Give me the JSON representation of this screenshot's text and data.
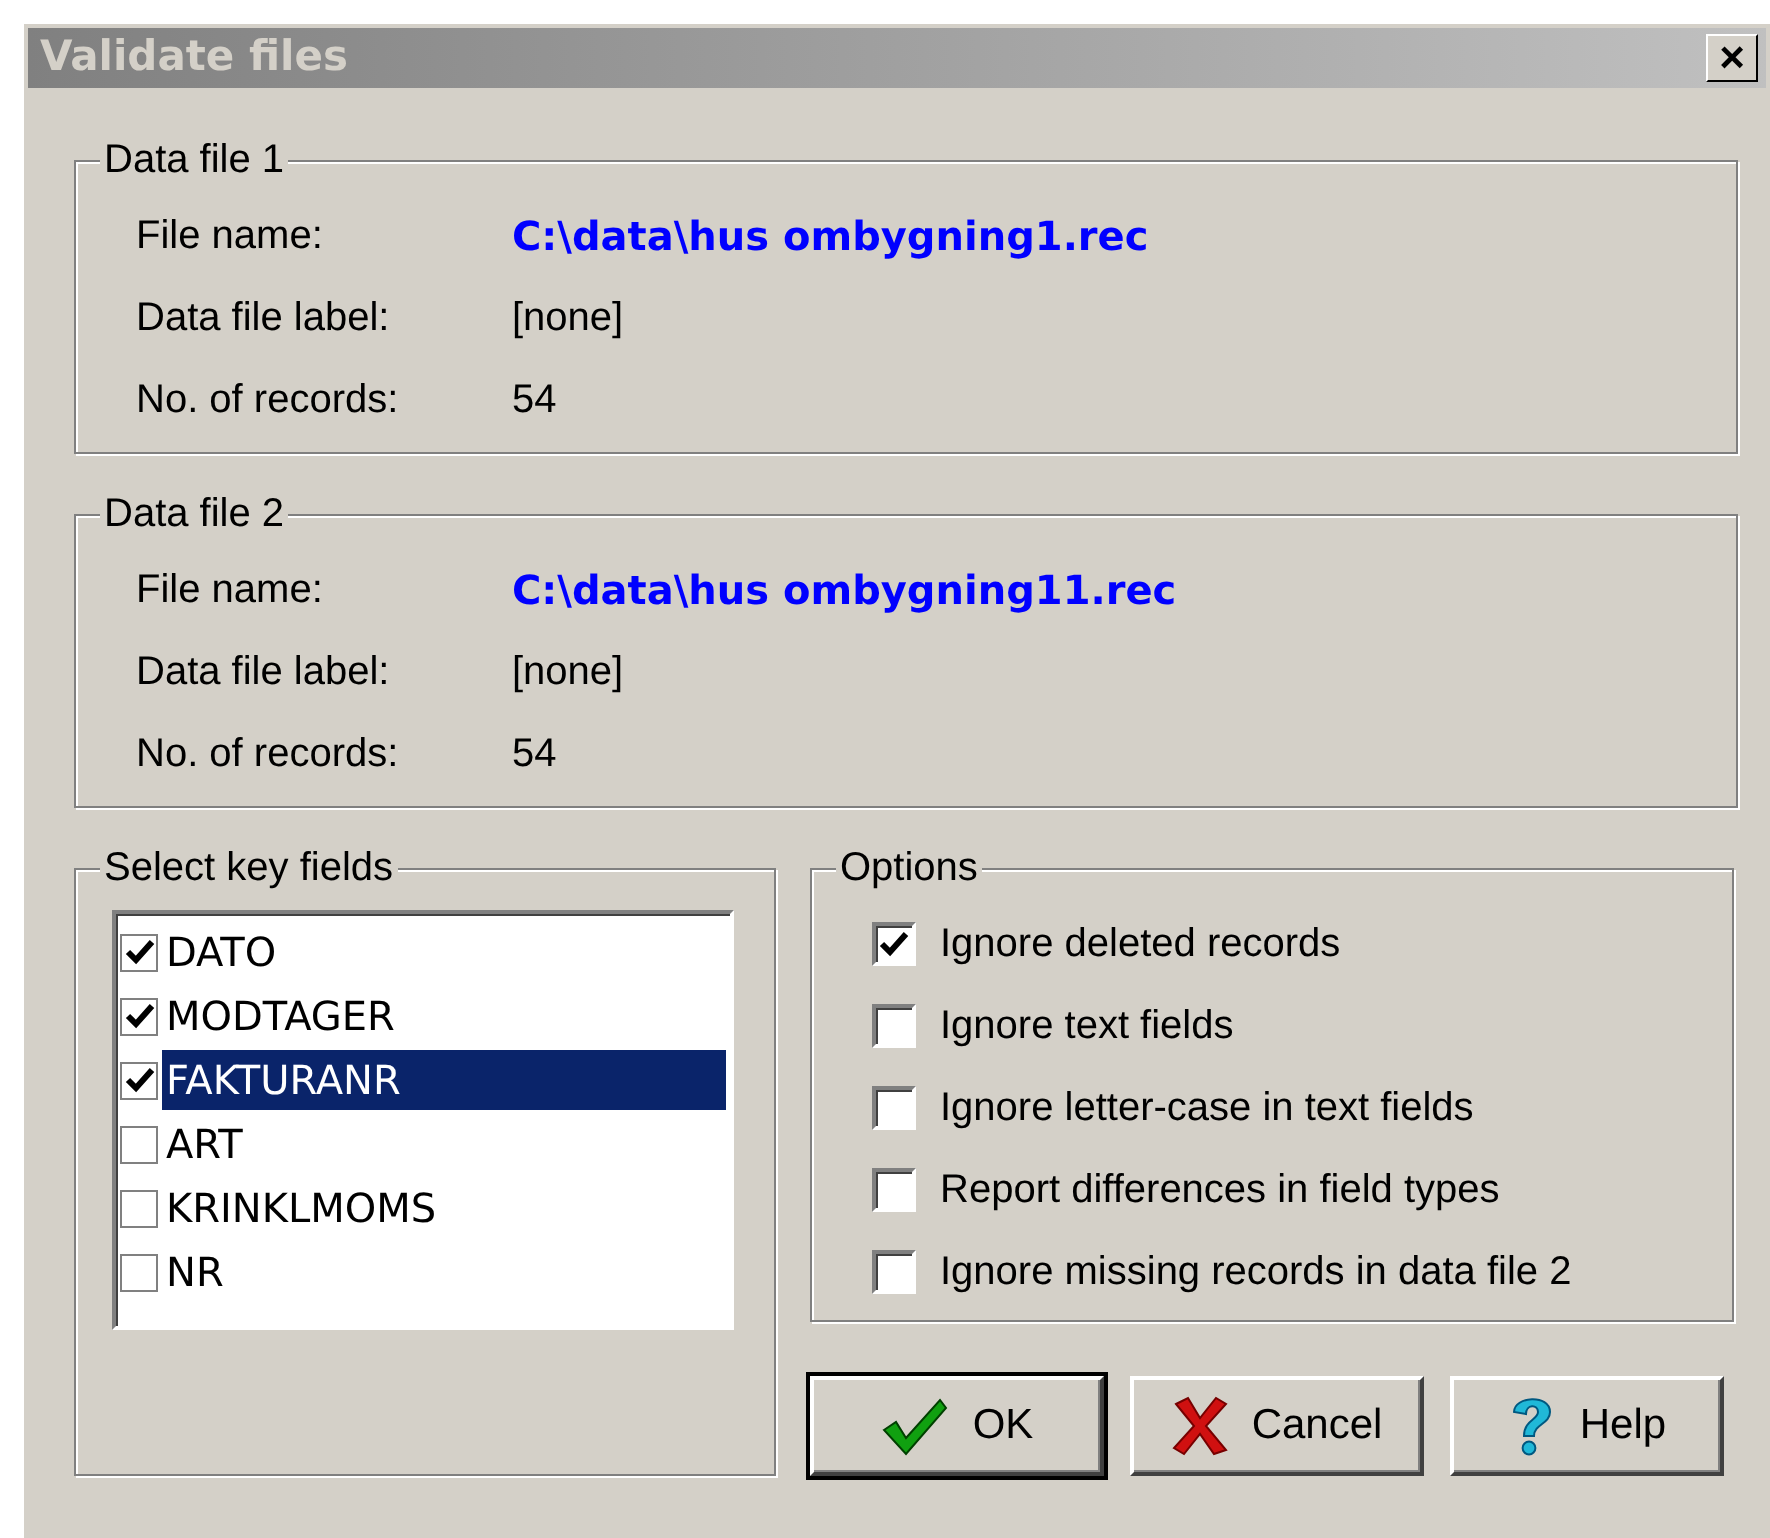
{
  "window": {
    "title": "Validate files",
    "close": "×"
  },
  "data_files": [
    {
      "title": "Data file 1",
      "rows": [
        {
          "label": "File name:",
          "value": "C:\\data\\hus ombygning1.rec",
          "kind": "path"
        },
        {
          "label": "Data file label:",
          "value": "[none]",
          "kind": "plain"
        },
        {
          "label": "No. of records:",
          "value": "54",
          "kind": "plain"
        }
      ]
    },
    {
      "title": "Data file 2",
      "rows": [
        {
          "label": "File name:",
          "value": "C:\\data\\hus ombygning11.rec",
          "kind": "path"
        },
        {
          "label": "Data file label:",
          "value": "[none]",
          "kind": "plain"
        },
        {
          "label": "No. of records:",
          "value": "54",
          "kind": "plain"
        }
      ]
    }
  ],
  "key_fields": {
    "title": "Select key fields",
    "items": [
      {
        "label": "DATO",
        "checked": true,
        "selected": false
      },
      {
        "label": "MODTAGER",
        "checked": true,
        "selected": false
      },
      {
        "label": "FAKTURANR",
        "checked": true,
        "selected": true
      },
      {
        "label": "ART",
        "checked": false,
        "selected": false
      },
      {
        "label": "KRINKLMOMS",
        "checked": false,
        "selected": false
      },
      {
        "label": "NR",
        "checked": false,
        "selected": false
      }
    ]
  },
  "options": {
    "title": "Options",
    "items": [
      {
        "label": "Ignore deleted records",
        "checked": true
      },
      {
        "label": "Ignore text fields",
        "checked": false
      },
      {
        "label": "Ignore letter-case in text fields",
        "checked": false
      },
      {
        "label": "Report differences in field types",
        "checked": false
      },
      {
        "label": "Ignore missing records in data file 2",
        "checked": false
      }
    ]
  },
  "buttons": [
    {
      "label": "OK",
      "kind": "ok",
      "default": true
    },
    {
      "label": "Cancel",
      "kind": "cancel",
      "default": false
    },
    {
      "label": "Help",
      "kind": "help",
      "default": false
    }
  ]
}
